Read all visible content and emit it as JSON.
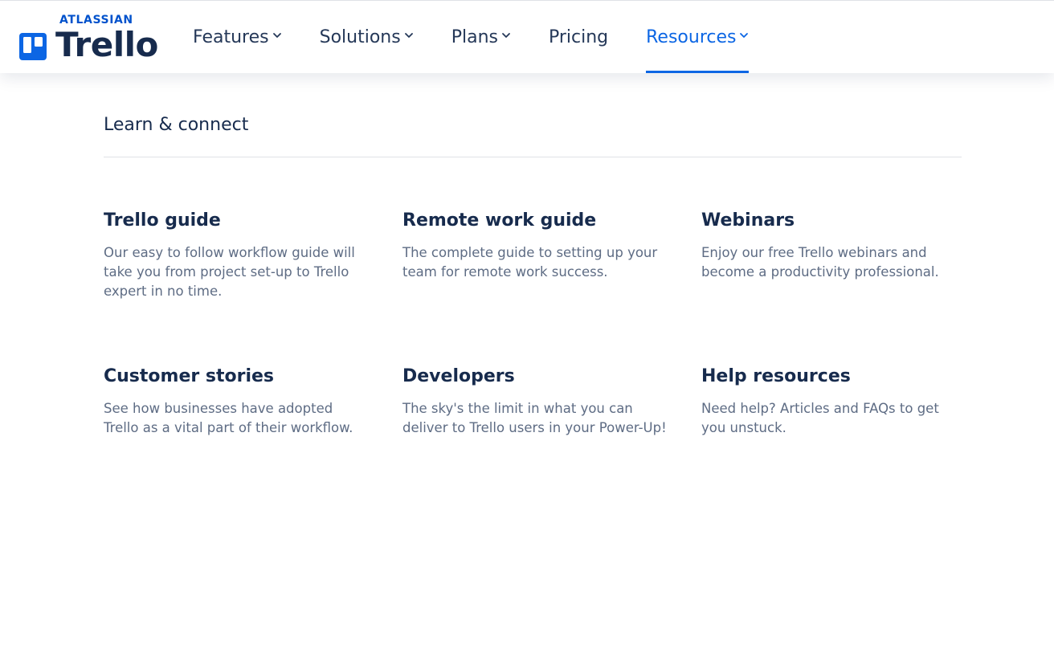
{
  "brand": {
    "company": "ATLASSIAN",
    "product": "Trello",
    "accent": "#0c66e4",
    "logo_color": "#0052cc"
  },
  "nav": {
    "items": [
      {
        "label": "Features",
        "has_dropdown": true
      },
      {
        "label": "Solutions",
        "has_dropdown": true
      },
      {
        "label": "Plans",
        "has_dropdown": true
      },
      {
        "label": "Pricing",
        "has_dropdown": false
      },
      {
        "label": "Resources",
        "has_dropdown": true,
        "active": true
      }
    ]
  },
  "panel": {
    "title": "Learn & connect",
    "cards": [
      {
        "title": "Trello guide",
        "description": "Our easy to follow workflow guide will take you from project set-up to Trello expert in no time."
      },
      {
        "title": "Remote work guide",
        "description": "The complete guide to setting up your team for remote work success."
      },
      {
        "title": "Webinars",
        "description": "Enjoy our free Trello webinars and become a productivity professional."
      },
      {
        "title": "Customer stories",
        "description": "See how businesses have adopted Trello as a vital part of their workflow."
      },
      {
        "title": "Developers",
        "description": "The sky's the limit in what you can deliver to Trello users in your Power-Up!"
      },
      {
        "title": "Help resources",
        "description": "Need help? Articles and FAQs to get you unstuck."
      }
    ]
  },
  "icons": {
    "logo_mark": "trello-board-icon",
    "dropdown": "chevron-down-icon"
  }
}
